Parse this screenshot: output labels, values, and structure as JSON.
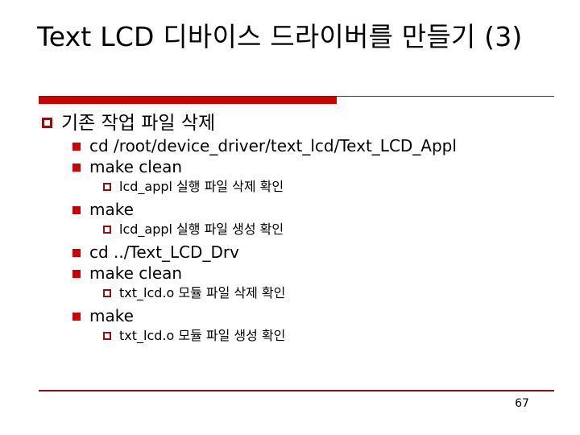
{
  "slide": {
    "title": "Text LCD 디바이스 드라이버를 만들기 (3)",
    "page_number": "67",
    "accent_color": "#cc0000",
    "accent_dark_color": "#8c1111",
    "background_color": "#ffffff",
    "text_color": "#000000"
  },
  "content": {
    "items": [
      {
        "level": 1,
        "bullet": "hollow-square-bullet",
        "text": "기존 작업 파일 삭제"
      },
      {
        "level": 2,
        "bullet": "filled-square-bullet",
        "text": "cd  /root/device_driver/text_lcd/Text_LCD_Appl"
      },
      {
        "level": 2,
        "bullet": "filled-square-bullet",
        "text": "make  clean"
      },
      {
        "level": 3,
        "bullet": "hollow-square-bullet",
        "text": "lcd_appl 실행 파일 삭제 확인"
      },
      {
        "level": 2,
        "bullet": "filled-square-bullet",
        "text": "make"
      },
      {
        "level": 3,
        "bullet": "hollow-square-bullet",
        "text": "lcd_appl 실행 파일 생성 확인"
      },
      {
        "level": 2,
        "bullet": "filled-square-bullet",
        "text": "cd  ../Text_LCD_Drv"
      },
      {
        "level": 2,
        "bullet": "filled-square-bullet",
        "text": "make clean"
      },
      {
        "level": 3,
        "bullet": "hollow-square-bullet",
        "text": "txt_lcd.o 모듈 파일 삭제 확인"
      },
      {
        "level": 2,
        "bullet": "filled-square-bullet",
        "text": "make"
      },
      {
        "level": 3,
        "bullet": "hollow-square-bullet",
        "text": "txt_lcd.o 모듈 파일 생성 확인"
      }
    ]
  }
}
